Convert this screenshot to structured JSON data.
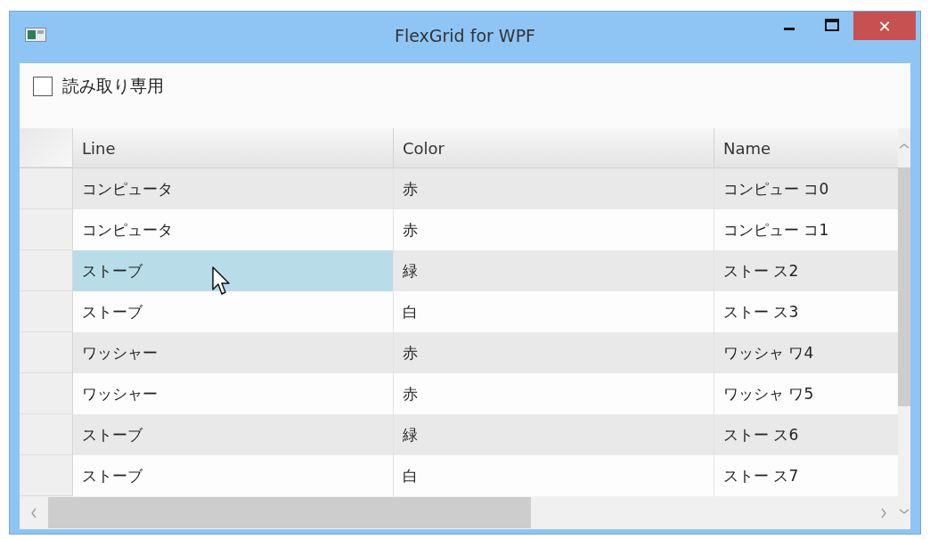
{
  "window": {
    "title": "FlexGrid for WPF",
    "close_symbol": "✕"
  },
  "read_only": {
    "label": "読み取り専用",
    "checked": false
  },
  "table": {
    "columns": [
      "Line",
      "Color",
      "Name"
    ],
    "rows": [
      {
        "line": "コンピュータ",
        "color_value": "赤",
        "name": "コンピュー コ0",
        "selected": false
      },
      {
        "line": "コンピュータ",
        "color_value": "赤",
        "name": "コンピュー コ1",
        "selected": false
      },
      {
        "line": "ストーブ",
        "color_value": "緑",
        "name": "ストー ス2",
        "selected": true
      },
      {
        "line": "ストーブ",
        "color_value": "白",
        "name": "ストー ス3",
        "selected": false
      },
      {
        "line": "ワッシャー",
        "color_value": "赤",
        "name": "ワッシャ ワ4",
        "selected": false
      },
      {
        "line": "ワッシャー",
        "color_value": "赤",
        "name": "ワッシャ ワ5",
        "selected": false
      },
      {
        "line": "ストーブ",
        "color_value": "緑",
        "name": "ストー ス6",
        "selected": false
      },
      {
        "line": "ストーブ",
        "color_value": "白",
        "name": "ストー ス7",
        "selected": false
      }
    ]
  }
}
